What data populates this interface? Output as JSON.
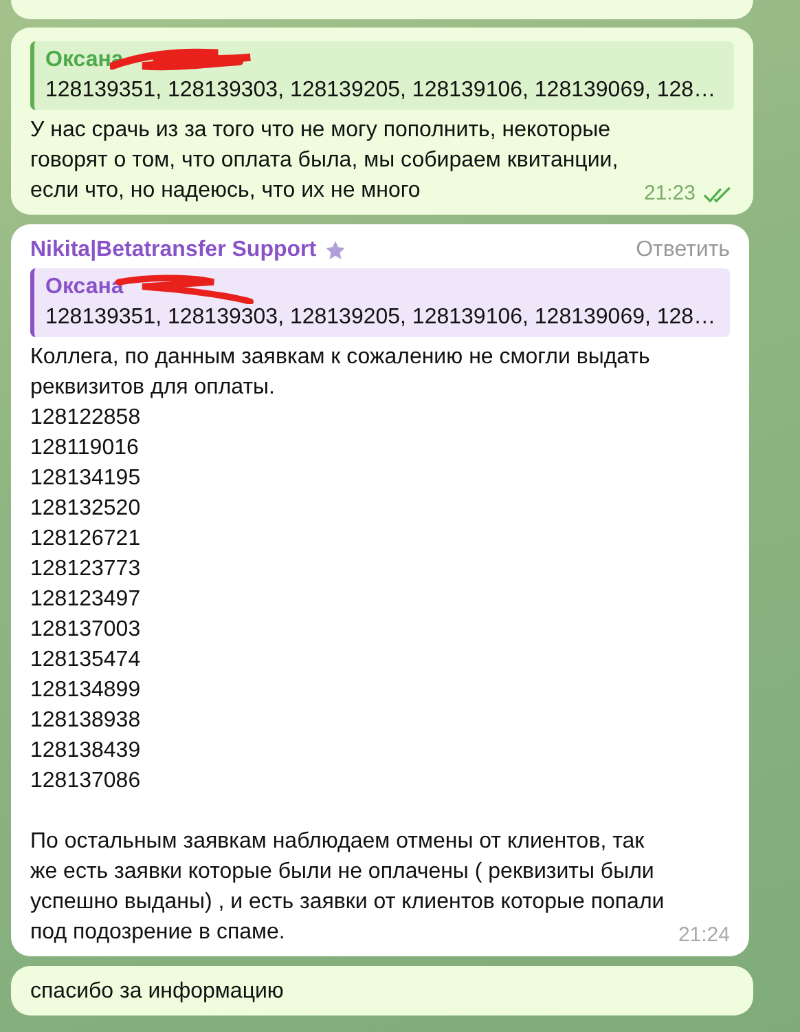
{
  "messages": [
    {
      "kind": "outgoing",
      "quote": {
        "name": "Оксана",
        "text": "128139351, 128139303, 128139205, 128139106, 128139069, 128…",
        "redacted": true
      },
      "blocks": [
        "У нас срачь из за того что не могу пополнить, некоторые говорят о том, что оплата была, мы собираем квитанции, если что, но надеюсь, что их не много"
      ],
      "time": "21:23",
      "read": true
    },
    {
      "kind": "incoming",
      "author": "Nikita|Betatransfer Support",
      "starred": true,
      "reply": "Ответить",
      "quote": {
        "name": "Оксана",
        "text": "128139351, 128139303, 128139205, 128139106, 128139069, 128…",
        "redacted": true
      },
      "blocks": [
        "Коллега, по данным заявкам к сожалению не смогли выдать реквизитов для оплаты.\n128122858\n128119016\n128134195\n128132520\n128126721\n128123773\n128123497\n128137003\n128135474\n128134899\n128138938\n128138439\n128137086",
        "По остальным заявкам наблюдаем отмены от клиентов, так же есть заявки которые были не оплачены ( реквизиты были успешно выданы) , и есть заявки от клиентов которые попали под подозрение в спаме."
      ],
      "time": "21:24"
    },
    {
      "kind": "outgoing",
      "blocks": [
        "спасибо за информацию"
      ]
    }
  ]
}
